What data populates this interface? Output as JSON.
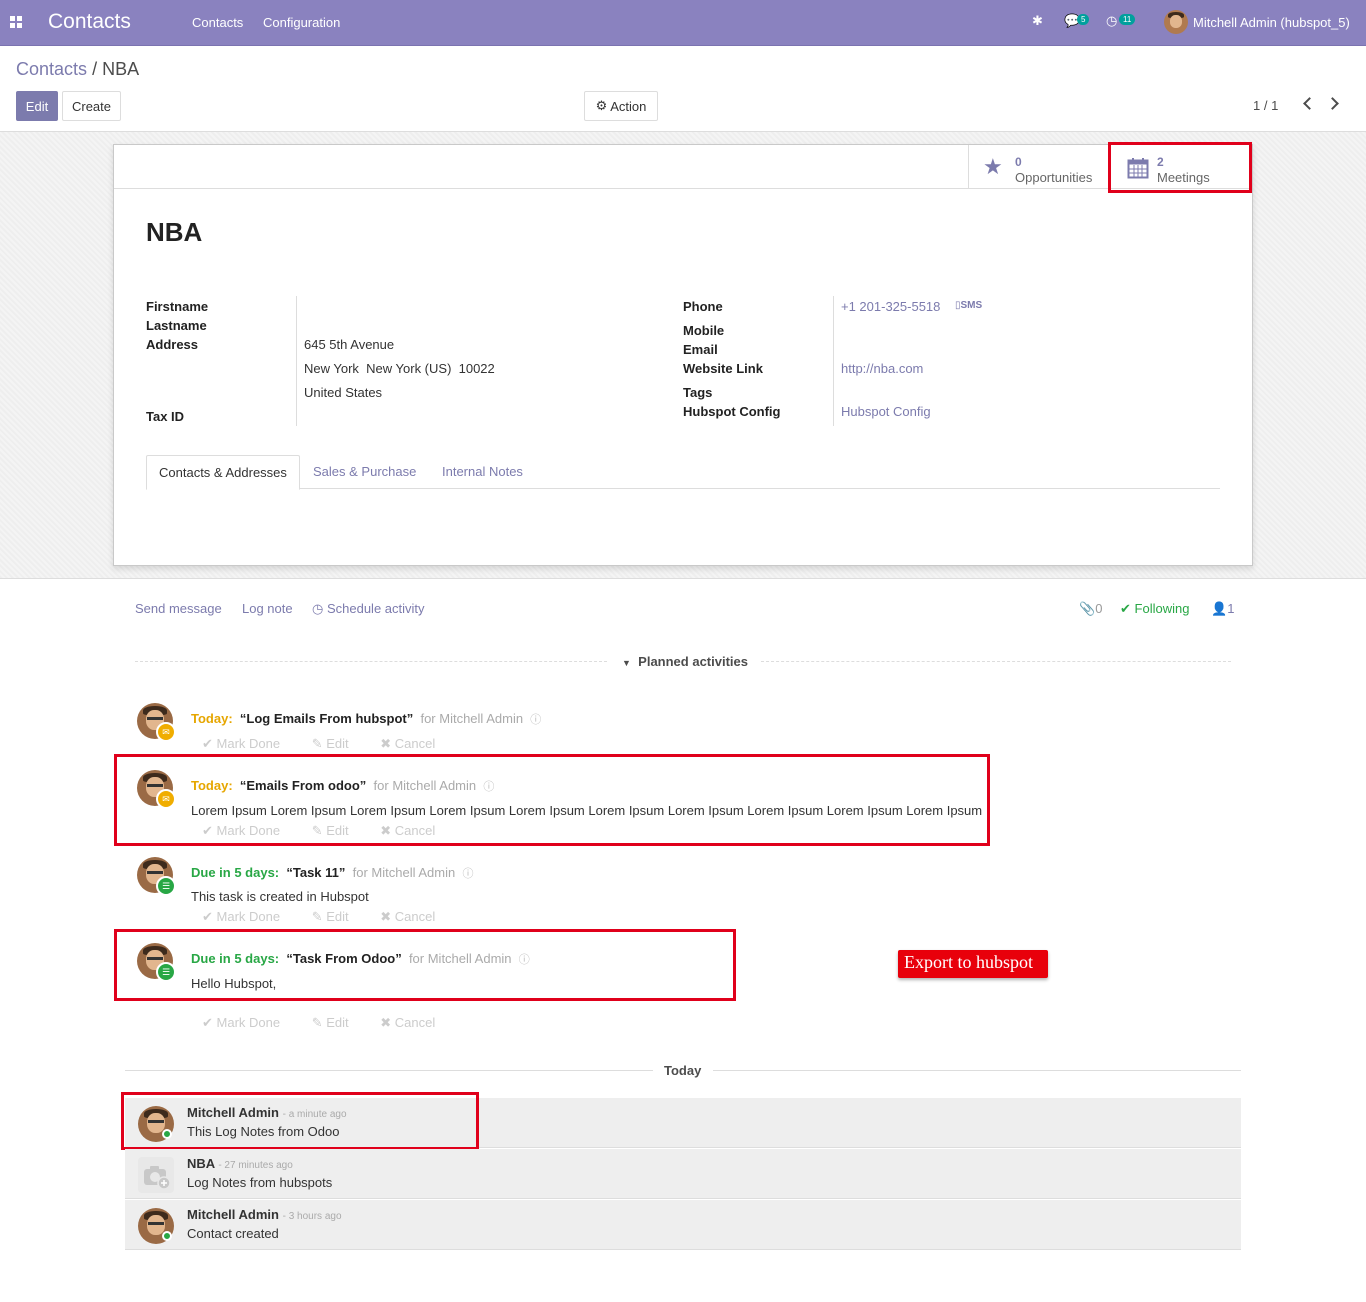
{
  "topbar": {
    "app_name": "Contacts",
    "menu": [
      "Contacts",
      "Configuration"
    ],
    "messages_count": "5",
    "activities_count": "11",
    "user_name": "Mitchell Admin (hubspot_5)"
  },
  "control_panel": {
    "breadcrumb_parent": "Contacts",
    "breadcrumb_sep": "/",
    "breadcrumb_current": "NBA",
    "edit_label": "Edit",
    "create_label": "Create",
    "action_label": "Action",
    "pager": "1 / 1"
  },
  "stat_buttons": {
    "opportunities_count": "0",
    "opportunities_label": "Opportunities",
    "meetings_count": "2",
    "meetings_label": "Meetings"
  },
  "record": {
    "name": "NBA",
    "left_fields": {
      "firstname_label": "Firstname",
      "lastname_label": "Lastname",
      "address_label": "Address",
      "street": "645 5th Avenue",
      "city_line": "New York  New York (US)  10022",
      "country": "United States",
      "tax_id_label": "Tax ID"
    },
    "right_fields": {
      "phone_label": "Phone",
      "phone_value": "+1 201-325-5518",
      "sms_label": "SMS",
      "mobile_label": "Mobile",
      "email_label": "Email",
      "website_label": "Website Link",
      "website_value": "http://nba.com",
      "tags_label": "Tags",
      "hubspot_config_label": "Hubspot Config",
      "hubspot_config_value": "Hubspot Config"
    },
    "tabs": [
      "Contacts & Addresses",
      "Sales & Purchase",
      "Internal Notes"
    ]
  },
  "chatter": {
    "send_message": "Send message",
    "log_note": "Log note",
    "schedule_activity": "Schedule activity",
    "attachments_count": "0",
    "following_label": "Following",
    "followers_count": "1",
    "planned_title": "Planned activities",
    "activities": [
      {
        "due": "Today:",
        "summary": "“Log Emails From hubspot”",
        "for": "for Mitchell Admin",
        "note": ""
      },
      {
        "due": "Today:",
        "summary": "“Emails From odoo”",
        "for": "for Mitchell Admin",
        "note": "Lorem Ipsum Lorem Ipsum Lorem Ipsum Lorem Ipsum Lorem Ipsum Lorem Ipsum Lorem Ipsum Lorem Ipsum Lorem Ipsum Lorem Ipsum"
      },
      {
        "due": "Due in 5 days:",
        "summary": "“Task 11”",
        "for": "for Mitchell Admin",
        "note": "This task is created in Hubspot"
      },
      {
        "due": "Due in 5 days:",
        "summary": "“Task From Odoo”",
        "for": "for Mitchell Admin",
        "note": "Hello Hubspot,"
      }
    ],
    "action_labels": {
      "mark_done": "Mark Done",
      "edit": "Edit",
      "cancel": "Cancel"
    },
    "export_label": "Export to hubspot",
    "today_title": "Today",
    "messages": [
      {
        "author": "Mitchell Admin",
        "time": "- a minute ago",
        "body": "This Log Notes from Odoo"
      },
      {
        "author": "NBA",
        "time": "- 27 minutes ago",
        "body": "Log Notes from hubspots"
      },
      {
        "author": "Mitchell Admin",
        "time": "- 3 hours ago",
        "body": "Contact created"
      }
    ]
  },
  "colors": {
    "brand": "#8a82bf",
    "link": "#7c7bad",
    "highlight": "#e0001b",
    "due_today": "#e6a600",
    "due_future": "#28a745"
  }
}
